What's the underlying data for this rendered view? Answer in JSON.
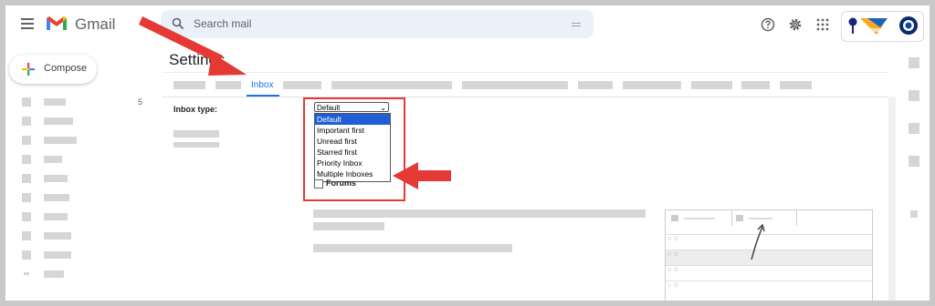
{
  "header": {
    "app_name": "Gmail",
    "search_placeholder": "Search mail"
  },
  "sidebar": {
    "compose_label": "Compose",
    "inbox_count": "5"
  },
  "settings": {
    "title": "Settings",
    "active_tab": "Inbox",
    "inbox_type_label": "Inbox type:",
    "select_value": "Default",
    "options": [
      "Default",
      "Important first",
      "Unread first",
      "Starred first",
      "Priority Inbox",
      "Multiple Inboxes"
    ],
    "selected_option_index": 0,
    "forums_label": "Forums"
  },
  "colors": {
    "accent": "#1a73e8",
    "annotation_red": "#e53935",
    "selection_blue": "#1e5fd6"
  },
  "icons": [
    "hamburger-menu-icon",
    "gmail-logo-icon",
    "search-icon",
    "search-options-icon",
    "help-icon",
    "gear-icon",
    "apps-grid-icon",
    "plus-icon"
  ]
}
